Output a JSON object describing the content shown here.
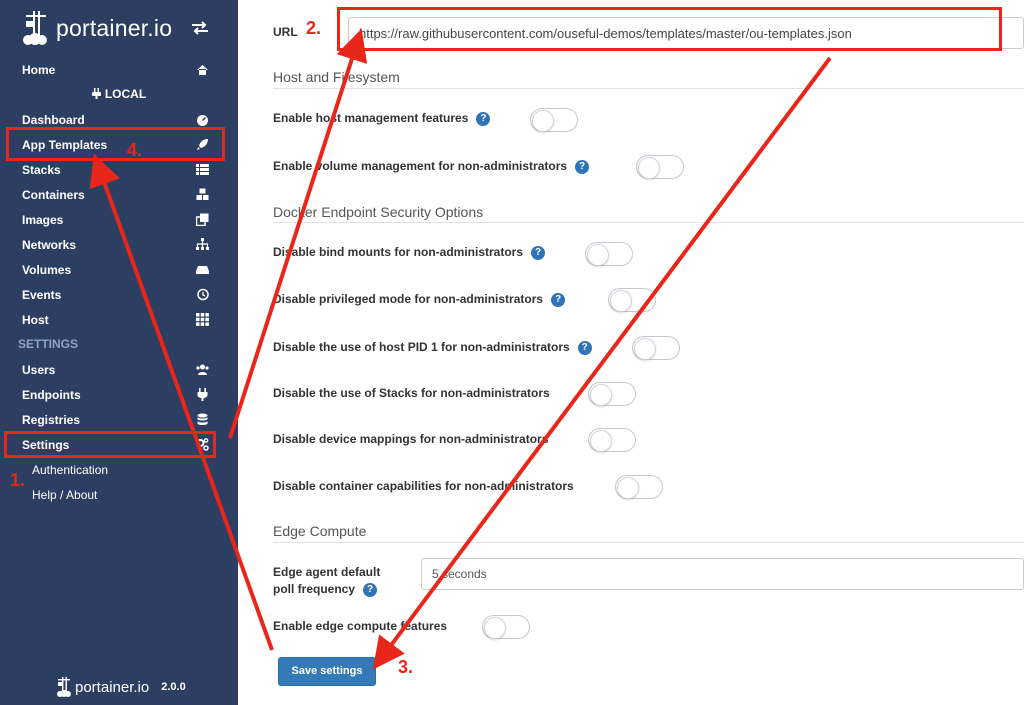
{
  "brand": {
    "name": "portainer.io"
  },
  "sidebar": {
    "home": "Home",
    "endpoint": "LOCAL",
    "items": [
      {
        "label": "Dashboard",
        "icon": "tachometer-icon"
      },
      {
        "label": "App Templates",
        "icon": "rocket-icon"
      },
      {
        "label": "Stacks",
        "icon": "list-icon"
      },
      {
        "label": "Containers",
        "icon": "cubes-icon"
      },
      {
        "label": "Images",
        "icon": "clone-icon"
      },
      {
        "label": "Networks",
        "icon": "sitemap-icon"
      },
      {
        "label": "Volumes",
        "icon": "hdd-icon"
      },
      {
        "label": "Events",
        "icon": "history-icon"
      },
      {
        "label": "Host",
        "icon": "th-icon"
      }
    ],
    "settings_title": "SETTINGS",
    "settings_items": [
      {
        "label": "Users",
        "icon": "users-icon"
      },
      {
        "label": "Endpoints",
        "icon": "plug-icon"
      },
      {
        "label": "Registries",
        "icon": "database-icon"
      },
      {
        "label": "Settings",
        "icon": "cogs-icon"
      }
    ],
    "sub_items": [
      "Authentication",
      "Help / About"
    ],
    "footer": {
      "brand": "portainer.io",
      "version": "2.0.0"
    }
  },
  "main": {
    "url_label": "URL",
    "url_value": "https://raw.githubusercontent.com/ouseful-demos/templates/master/ou-templates.json",
    "host_section": "Host and Filesystem",
    "host_options": [
      "Enable host management features",
      "Enable volume management for non-administrators"
    ],
    "security_section": "Docker Endpoint Security Options",
    "security_options": [
      "Disable bind mounts for non-administrators",
      "Disable privileged mode for non-administrators",
      "Disable the use of host PID 1 for non-administrators",
      "Disable the use of Stacks for non-administrators",
      "Disable device mappings for non-administrators",
      "Disable container capabilities for non-administrators"
    ],
    "edge_section": "Edge Compute",
    "edge_poll_label_1": "Edge agent default",
    "edge_poll_label_2": "poll frequency",
    "edge_poll_value": "5 seconds",
    "edge_enable_label": "Enable edge compute features",
    "save_button": "Save settings",
    "help_glyph": "?"
  },
  "annotations": {
    "step1": "1.",
    "step2": "2.",
    "step3": "3.",
    "step4": "4.",
    "color": "#e8271a"
  },
  "colors": {
    "sidebar_bg": "#2d3e63",
    "primary": "#337ab7",
    "help": "#2f75b5"
  }
}
